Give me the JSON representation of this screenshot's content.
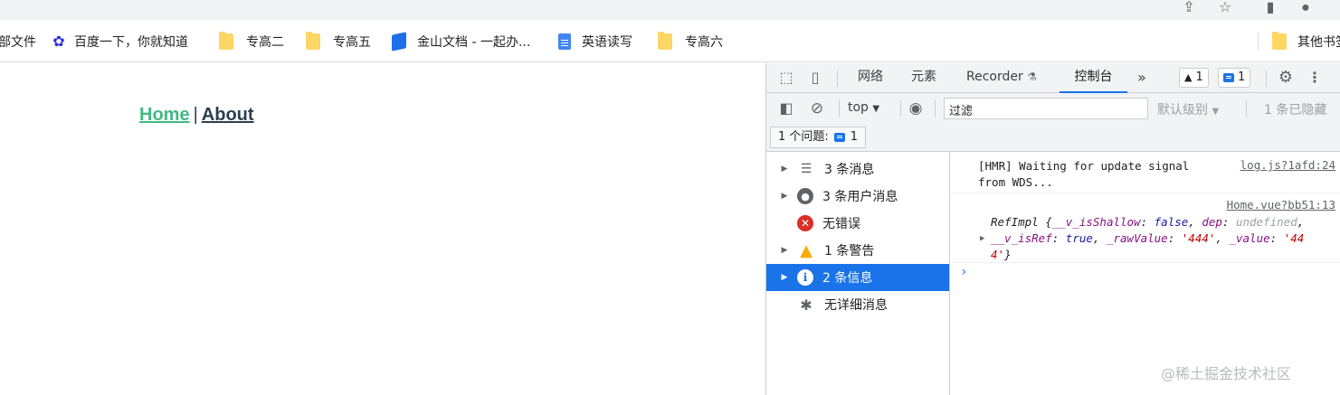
{
  "bookmarks": [
    {
      "label": "部文件",
      "icon": "folder-icon"
    },
    {
      "label": "百度一下，你就知道",
      "icon": "baidu-icon"
    },
    {
      "label": "专高二",
      "icon": "folder-icon"
    },
    {
      "label": "专高五",
      "icon": "folder-icon"
    },
    {
      "label": "金山文档 - 一起办...",
      "icon": "kingsoft-docs-icon"
    },
    {
      "label": "英语读写",
      "icon": "google-docs-icon"
    },
    {
      "label": "专高六",
      "icon": "folder-icon"
    },
    {
      "label": "其他书签",
      "icon": "folder-icon"
    }
  ],
  "page": {
    "nav_home": "Home",
    "nav_separator": "|",
    "nav_about": "About",
    "home_color": "#42b983",
    "about_color": "#2c3e50"
  },
  "devtools": {
    "tabs": [
      "网络",
      "元素",
      "Recorder",
      "控制台"
    ],
    "active_tab": "控制台",
    "recorder_icon": "flask-icon",
    "more_tabs": "»",
    "warnings_badge": "1",
    "messages_badge": "1",
    "context": "top",
    "filter_value": "过滤",
    "levels_label": "默认级别",
    "hidden_label": "1 条已隐藏",
    "issues_label": "1 个问题:",
    "issues_count": "1",
    "sidebar": [
      {
        "label": "3 条消息",
        "icon": "list-icon",
        "expandable": true
      },
      {
        "label": "3 条用户消息",
        "icon": "user-icon",
        "expandable": true
      },
      {
        "label": "无错误",
        "icon": "error-icon",
        "expandable": false
      },
      {
        "label": "1 条警告",
        "icon": "warning-icon",
        "expandable": true
      },
      {
        "label": "2 条信息",
        "icon": "info-icon",
        "expandable": true,
        "selected": true
      },
      {
        "label": "无详细消息",
        "icon": "bug-icon",
        "expandable": false
      }
    ],
    "console": {
      "log1_line1": "[HMR] Waiting for update signal",
      "log1_line2": "from WDS...",
      "log1_source": "log.js?1afd:24",
      "log2_source": "Home.vue?bb51:13",
      "log2_prefix": "RefImpl {",
      "log2_k1": "__v_isShallow",
      "log2_v1": "false",
      "log2_k2": "dep",
      "log2_v2": "undefined",
      "log2_k3": "__v_isRef",
      "log2_v3": "true",
      "log2_k4": "_rawValue",
      "log2_v4": "'444'",
      "log2_k5": "_value",
      "log2_v5a": "'44",
      "log2_v5b": "4'",
      "log2_suffix": "}",
      "prompt": "›"
    },
    "accent_color": "#1a73e8"
  },
  "watermark": "@稀土掘金技术社区"
}
